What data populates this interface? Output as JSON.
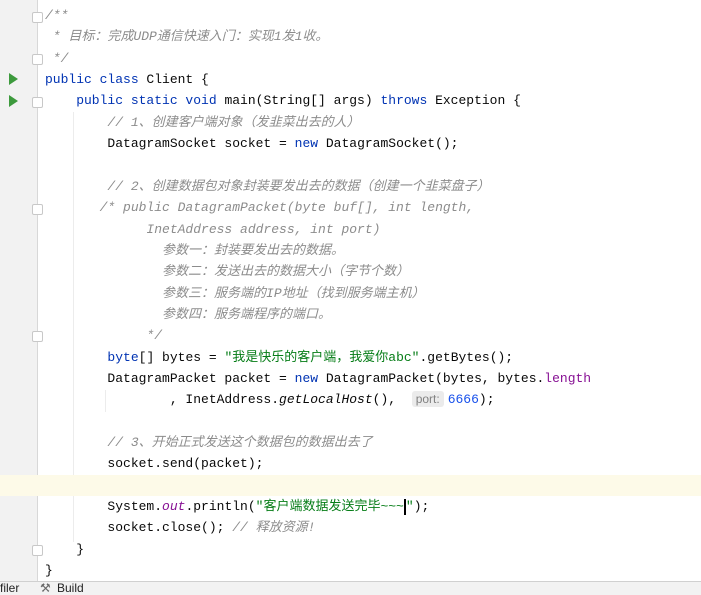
{
  "editor": {
    "current_line": 23,
    "lines": [
      [
        [
          "/**",
          "cm"
        ]
      ],
      [
        [
          " * 目标：完成UDP通信快速入门：实现1发1收。",
          "cm"
        ]
      ],
      [
        [
          " */",
          "cm"
        ]
      ],
      [
        [
          "public class ",
          "kw"
        ],
        [
          "Client {",
          ""
        ]
      ],
      [
        [
          "    public static void ",
          "kw"
        ],
        [
          "main(String[] args) ",
          ""
        ],
        [
          "throws ",
          "kw"
        ],
        [
          "Exception {",
          ""
        ]
      ],
      [
        [
          "        // 1、创建客户端对象（发韭菜出去的人）",
          "cm"
        ]
      ],
      [
        [
          "        DatagramSocket socket = ",
          ""
        ],
        [
          "new ",
          "kw"
        ],
        [
          "DatagramSocket();",
          ""
        ]
      ],
      [
        [
          "",
          ""
        ]
      ],
      [
        [
          "        // 2、创建数据包对象封装要发出去的数据（创建一个韭菜盘子）",
          "cm"
        ]
      ],
      [
        [
          "       /* public DatagramPacket(byte buf[], int length,",
          "cm"
        ]
      ],
      [
        [
          "             InetAddress address, int port)",
          "cm"
        ]
      ],
      [
        [
          "               参数一：封装要发出去的数据。",
          "cm"
        ]
      ],
      [
        [
          "               参数二：发送出去的数据大小（字节个数）",
          "cm"
        ]
      ],
      [
        [
          "               参数三：服务端的IP地址（找到服务端主机）",
          "cm"
        ]
      ],
      [
        [
          "               参数四：服务端程序的端口。",
          "cm"
        ]
      ],
      [
        [
          "             */",
          "cm"
        ]
      ],
      [
        [
          "        ",
          ""
        ],
        [
          "byte",
          "kw"
        ],
        [
          "[] bytes = ",
          ""
        ],
        [
          "\"我是快乐的客户端，我爱你abc\"",
          "st"
        ],
        [
          ".getBytes();",
          ""
        ]
      ],
      [
        [
          "        DatagramPacket packet = ",
          ""
        ],
        [
          "new ",
          "kw"
        ],
        [
          "DatagramPacket(bytes, bytes.",
          ""
        ],
        [
          "length",
          "fd"
        ]
      ],
      [
        [
          "                , InetAddress.",
          ""
        ],
        [
          "getLocalHost",
          "it"
        ],
        [
          "(),  ",
          ""
        ],
        [
          "port:",
          "hint"
        ],
        [
          "6666",
          "nm"
        ],
        [
          ");",
          ""
        ]
      ],
      [
        [
          "",
          ""
        ]
      ],
      [
        [
          "        // 3、开始正式发送这个数据包的数据出去了",
          "cm"
        ]
      ],
      [
        [
          "        socket.send(packet);",
          ""
        ]
      ],
      [
        [
          "",
          ""
        ]
      ],
      [
        [
          "        System.",
          ""
        ],
        [
          "out",
          "fd it"
        ],
        [
          ".println(",
          ""
        ],
        [
          "\"客户端数据发送完毕~~~",
          "st"
        ],
        [
          "",
          "caret"
        ],
        [
          "\"",
          "st"
        ],
        [
          ");",
          ""
        ]
      ],
      [
        [
          "        socket.close(); ",
          ""
        ],
        [
          "// 释放资源!",
          "cm"
        ]
      ],
      [
        [
          "    }",
          ""
        ]
      ],
      [
        [
          "}",
          ""
        ]
      ]
    ]
  },
  "bottom_bar": {
    "tabs": [
      {
        "label": "filer",
        "icon": "profiler-icon"
      },
      {
        "label": "Build",
        "icon": "hammer-icon"
      }
    ]
  },
  "colors": {
    "keyword": "#0033b3",
    "comment": "#8c8c8c",
    "string": "#067d17",
    "field": "#871094",
    "number": "#1750eb",
    "run": "#3d9a3d"
  }
}
